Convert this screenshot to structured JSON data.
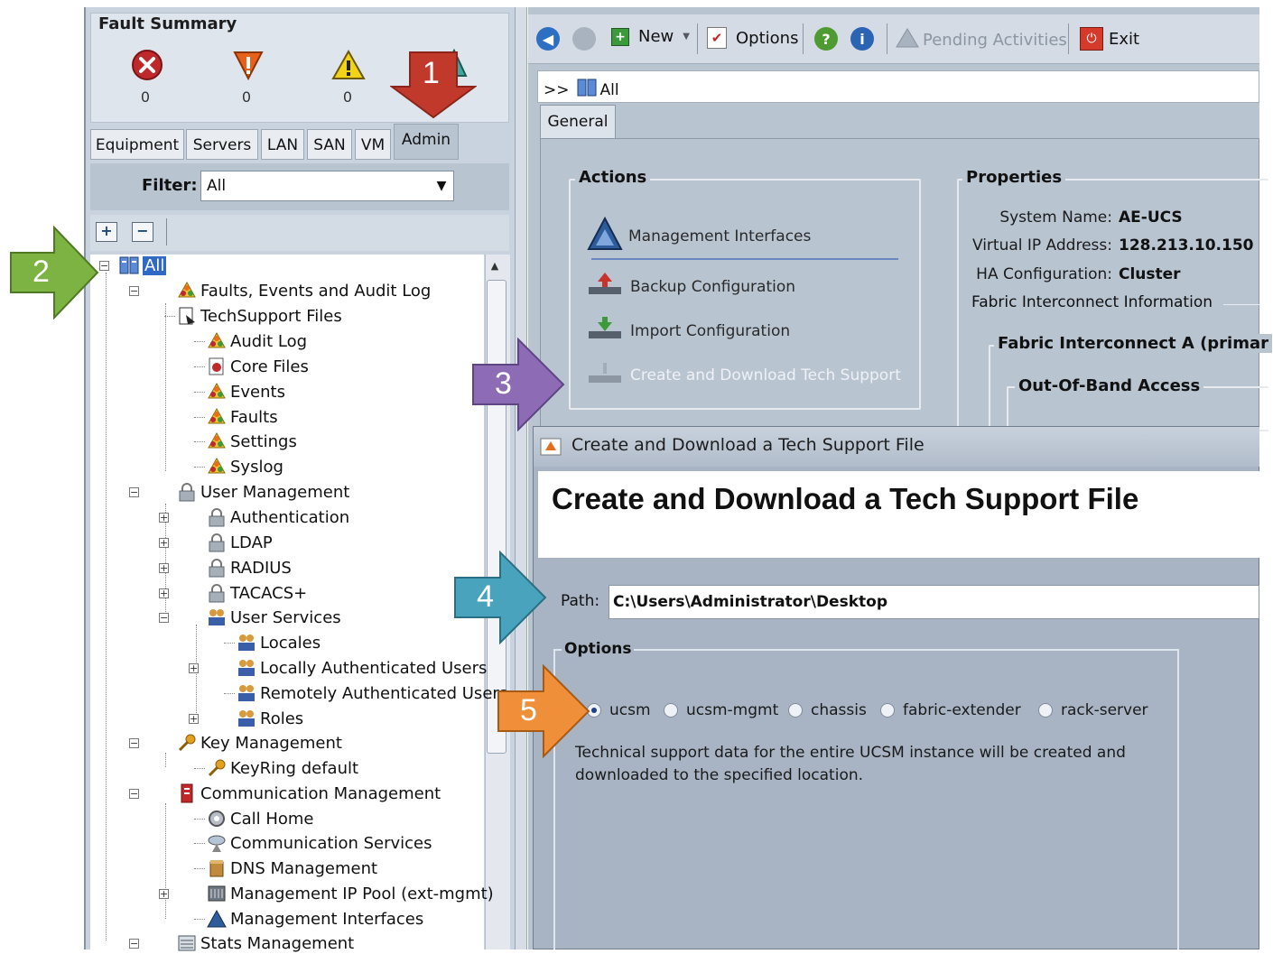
{
  "fault_summary": {
    "title": "Fault Summary",
    "counts": [
      "0",
      "0",
      "0"
    ]
  },
  "tabs": [
    "Equipment",
    "Servers",
    "LAN",
    "SAN",
    "VM",
    "Admin"
  ],
  "filter": {
    "label": "Filter:",
    "value": "All"
  },
  "tree": {
    "root": "All",
    "items": [
      "Faults, Events and Audit Log",
      "TechSupport Files",
      "Audit Log",
      "Core Files",
      "Events",
      "Faults",
      "Settings",
      "Syslog",
      "User Management",
      "Authentication",
      "LDAP",
      "RADIUS",
      "TACACS+",
      "User Services",
      "Locales",
      "Locally Authenticated Users",
      "Remotely Authenticated Users",
      "Roles",
      "Key Management",
      "KeyRing default",
      "Communication Management",
      "Call Home",
      "Communication Services",
      "DNS Management",
      "Management IP Pool (ext-mgmt)",
      "Management Interfaces",
      "Stats Management"
    ]
  },
  "toolbar": {
    "new": "New",
    "options": "Options",
    "pending": "Pending Activities",
    "exit": "Exit"
  },
  "breadcrumb": {
    "prefix": ">>",
    "label": "All"
  },
  "general_tab": "General",
  "actions": {
    "title": "Actions",
    "items": [
      "Management Interfaces",
      "Backup Configuration",
      "Import Configuration",
      "Create and Download Tech Support"
    ]
  },
  "properties": {
    "title": "Properties",
    "system_name_label": "System Name:",
    "system_name": "AE-UCS",
    "vip_label": "Virtual IP Address:",
    "vip": "128.213.10.150",
    "ha_label": "HA Configuration:",
    "ha": "Cluster",
    "fi_info": "Fabric Interconnect Information",
    "fi_a": "Fabric Interconnect A (primar",
    "oob": "Out-Of-Band Access"
  },
  "dialog": {
    "title": "Create and Download a Tech Support File",
    "heading": "Create and Download a Tech Support File",
    "path_label": "Path:",
    "path_value": "C:\\Users\\Administrator\\Desktop",
    "options_title": "Options",
    "radios": [
      "ucsm",
      "ucsm-mgmt",
      "chassis",
      "fabric-extender",
      "rack-server"
    ],
    "selected": "ucsm",
    "description": "Technical support data for the entire UCSM instance will be created and downloaded to the specified location."
  },
  "callouts": [
    "1",
    "2",
    "3",
    "4",
    "5"
  ],
  "colors": {
    "callout1": "#c0392b",
    "callout2": "#7cb342",
    "callout3": "#8e6bb5",
    "callout4": "#4aa3bd",
    "callout5": "#ef8f3a"
  }
}
